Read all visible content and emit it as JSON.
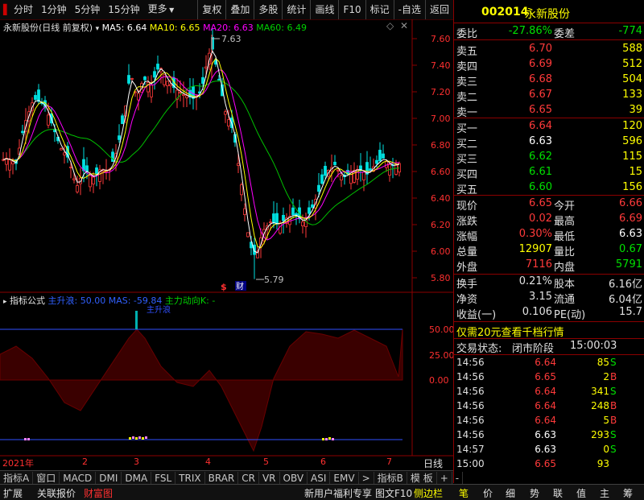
{
  "toolbar": {
    "left_items": [
      "分时",
      "1分钟",
      "5分钟",
      "15分钟",
      "更多"
    ],
    "right_items": [
      "复权",
      "叠加",
      "多股",
      "统计",
      "画线",
      "F10",
      "标记",
      "-自选",
      "返回"
    ]
  },
  "main_chart": {
    "title": "永新股份(日线 前复权)",
    "ma5": "MA5: 6.64",
    "ma10": "MA10: 6.65",
    "ma20": "MA20: 6.63",
    "ma60": "MA60: 6.49",
    "high_label": "7.63",
    "low_label": "5.79",
    "markers": [
      "$",
      "财"
    ],
    "y_ticks": [
      "7.60",
      "7.40",
      "7.20",
      "7.00",
      "6.80",
      "6.60",
      "6.40",
      "6.20",
      "6.00",
      "5.80"
    ]
  },
  "indicator": {
    "title": "指标公式",
    "zhusheng": "主升浪: 50.00",
    "mas": "MAS: -59.84",
    "zhuli": "主力动向K: -",
    "peak_label": "主升浪",
    "y_ticks": [
      "50.00",
      "25.00",
      "0.00"
    ]
  },
  "axis": {
    "year": "2021年",
    "months": [
      "2",
      "3",
      "4",
      "5",
      "6",
      "7"
    ],
    "period": "日线"
  },
  "tabs_row": [
    "指标A",
    "窗口",
    "MACD",
    "DMI",
    "DMA",
    "FSL",
    "TRIX",
    "BRAR",
    "CR",
    "VR",
    "OBV",
    "ASI",
    "EMV",
    ">",
    "指标B",
    "模 板",
    "+",
    "-"
  ],
  "bottom_row": {
    "left": [
      "扩展",
      "关联报价",
      "财富图"
    ],
    "promo": "新用户福利专享",
    "f10": "图文F10",
    "side": "侧边栏",
    "right_tabs": [
      "笔",
      "价",
      "细",
      "势",
      "联",
      "值",
      "主",
      "筹"
    ]
  },
  "quote": {
    "code": "002014",
    "name": "永新股份",
    "weibi_label": "委比",
    "weibi": "-27.86%",
    "weicha_label": "委差",
    "weicha": "-774",
    "asks": [
      {
        "label": "卖五",
        "price": "6.70",
        "vol": "588"
      },
      {
        "label": "卖四",
        "price": "6.69",
        "vol": "512"
      },
      {
        "label": "卖三",
        "price": "6.68",
        "vol": "504"
      },
      {
        "label": "卖二",
        "price": "6.67",
        "vol": "133"
      },
      {
        "label": "卖一",
        "price": "6.65",
        "vol": "39"
      }
    ],
    "bids": [
      {
        "label": "买一",
        "price": "6.64",
        "vol": "120"
      },
      {
        "label": "买二",
        "price": "6.63",
        "vol": "596"
      },
      {
        "label": "买三",
        "price": "6.62",
        "vol": "115"
      },
      {
        "label": "买四",
        "price": "6.61",
        "vol": "15"
      },
      {
        "label": "买五",
        "price": "6.60",
        "vol": "156"
      }
    ],
    "stats": [
      {
        "l1": "现价",
        "v1": "6.65",
        "l2": "今开",
        "v2": "6.66"
      },
      {
        "l1": "涨跌",
        "v1": "0.02",
        "l2": "最高",
        "v2": "6.69"
      },
      {
        "l1": "涨幅",
        "v1": "0.30%",
        "l2": "最低",
        "v2": "6.63"
      },
      {
        "l1": "总量",
        "v1": "12907",
        "l2": "量比",
        "v2": "0.67"
      },
      {
        "l1": "外盘",
        "v1": "7116",
        "l2": "内盘",
        "v2": "5791"
      }
    ],
    "stats2": [
      {
        "l1": "换手",
        "v1": "0.21%",
        "l2": "股本",
        "v2": "6.16亿"
      },
      {
        "l1": "净资",
        "v1": "3.15",
        "l2": "流通",
        "v2": "6.04亿"
      },
      {
        "l1": "收益(一)",
        "v1": "0.106",
        "l2": "PE(动)",
        "v2": "15.7"
      }
    ],
    "promo": "仅需20元查看千档行情",
    "status_label": "交易状态:",
    "status_value": "闭市阶段",
    "status_time": "15:00:03",
    "ticks": [
      {
        "time": "14:56",
        "price": "6.64",
        "vol": "85",
        "side": "S"
      },
      {
        "time": "14:56",
        "price": "6.65",
        "vol": "2",
        "side": "B"
      },
      {
        "time": "14:56",
        "price": "6.64",
        "vol": "341",
        "side": "S"
      },
      {
        "time": "14:56",
        "price": "6.64",
        "vol": "248",
        "side": "B"
      },
      {
        "time": "14:56",
        "price": "6.64",
        "vol": "5",
        "side": "B"
      },
      {
        "time": "14:56",
        "price": "6.63",
        "vol": "293",
        "side": "S"
      },
      {
        "time": "14:57",
        "price": "6.63",
        "vol": "0",
        "side": "S"
      },
      {
        "time": "15:00",
        "price": "6.65",
        "vol": "93",
        "side": ""
      }
    ]
  },
  "colors": {
    "up": "#ff3a3a",
    "down": "#00e000",
    "ma5": "#ffffff",
    "ma10": "#ffff00",
    "ma20": "#ff00ff",
    "ma60": "#00c000",
    "grid": "#8b0000"
  }
}
